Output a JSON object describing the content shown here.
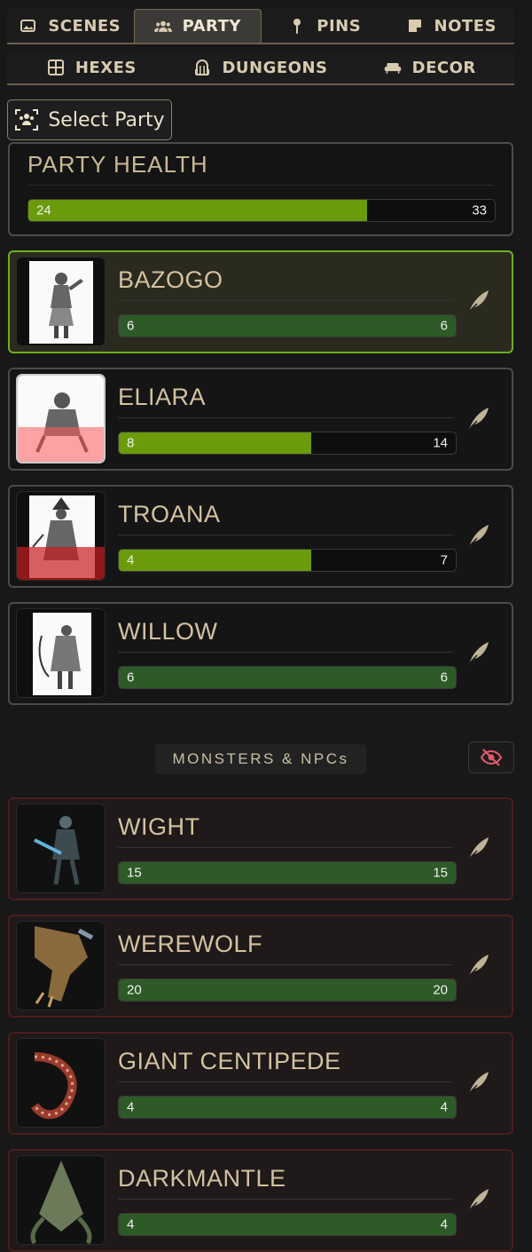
{
  "tabs_primary": [
    {
      "label": "SCENES",
      "icon": "image-icon"
    },
    {
      "label": "PARTY",
      "icon": "users-icon",
      "active": true
    },
    {
      "label": "PINS",
      "icon": "pin-icon"
    },
    {
      "label": "NOTES",
      "icon": "note-icon"
    }
  ],
  "tabs_secondary": [
    {
      "label": "HEXES",
      "icon": "grid-icon"
    },
    {
      "label": "DUNGEONS",
      "icon": "dungeon-icon"
    },
    {
      "label": "DECOR",
      "icon": "couch-icon"
    }
  ],
  "select_party": {
    "label": "Select Party",
    "icon": "group-select-icon"
  },
  "party_health": {
    "title": "PARTY HEALTH",
    "current": "24",
    "max": "33",
    "fraction": 0.727,
    "color": "#6b9a0b"
  },
  "party": [
    {
      "name": "BAZOGO",
      "hp": "6",
      "max_hp": "6",
      "fraction": 1.0,
      "selected": true,
      "bar_color": "#2d5a27"
    },
    {
      "name": "ELIARA",
      "hp": "8",
      "max_hp": "14",
      "fraction": 0.571,
      "bar_color": "#6b9a0b",
      "damage_overlay": 0.4
    },
    {
      "name": "TROANA",
      "hp": "4",
      "max_hp": "7",
      "fraction": 0.571,
      "bar_color": "#6b9a0b",
      "damage_overlay": 0.4
    },
    {
      "name": "WILLOW",
      "hp": "6",
      "max_hp": "6",
      "fraction": 1.0,
      "bar_color": "#2d5a27"
    }
  ],
  "monsters_label": "MONSTERS & NPCs",
  "monsters": [
    {
      "name": "WIGHT",
      "hp": "15",
      "max_hp": "15",
      "fraction": 1.0,
      "bar_color": "#2d5a27"
    },
    {
      "name": "WEREWOLF",
      "hp": "20",
      "max_hp": "20",
      "fraction": 1.0,
      "bar_color": "#2d5a27"
    },
    {
      "name": "GIANT CENTIPEDE",
      "hp": "4",
      "max_hp": "4",
      "fraction": 1.0,
      "bar_color": "#2d5a27"
    },
    {
      "name": "DARKMANTLE",
      "hp": "4",
      "max_hp": "4",
      "fraction": 1.0,
      "bar_color": "#2d5a27"
    }
  ],
  "colors": {
    "accent": "#6fae1f",
    "monster_border": "#4a1d1d",
    "hide_icon": "#e05a6a"
  }
}
